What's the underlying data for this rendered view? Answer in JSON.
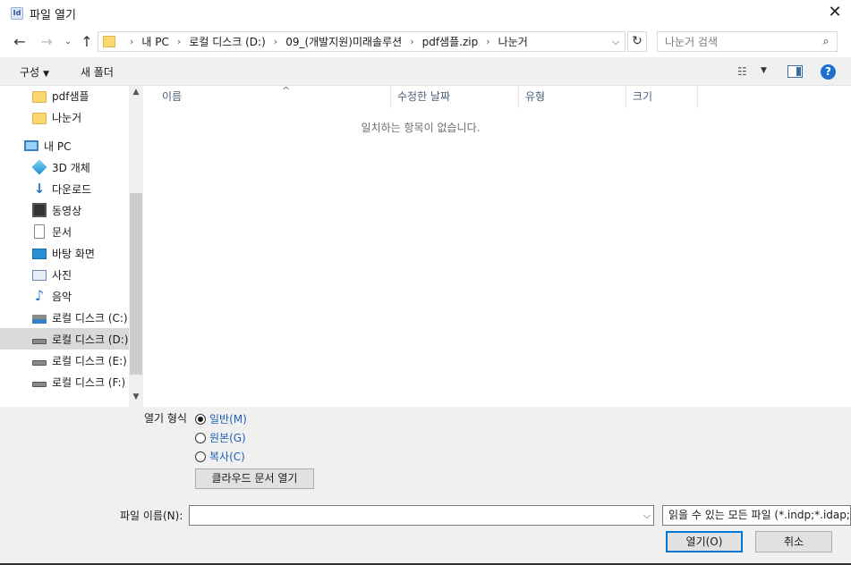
{
  "window": {
    "title": "파일 열기",
    "app_icon_text": "Id"
  },
  "address": {
    "crumbs": [
      "내 PC",
      "로컬 디스크 (D:)",
      "09_(개발지원)미래솔루션",
      "pdf샘플.zip",
      "나눈거"
    ]
  },
  "search": {
    "placeholder": "나눈거 검색"
  },
  "toolbar": {
    "organize_label": "구성",
    "new_folder_label": "새 폴더"
  },
  "nav_pane": {
    "items": [
      {
        "label": "pdf샘플",
        "icon": "folder-icon"
      },
      {
        "label": "나눈거",
        "icon": "folder-icon"
      },
      {
        "label": "내 PC",
        "icon": "computer-icon"
      },
      {
        "label": "3D 개체",
        "icon": "3d-objects-icon"
      },
      {
        "label": "다운로드",
        "icon": "download-icon"
      },
      {
        "label": "동영상",
        "icon": "video-icon"
      },
      {
        "label": "문서",
        "icon": "document-icon"
      },
      {
        "label": "바탕 화면",
        "icon": "desktop-icon"
      },
      {
        "label": "사진",
        "icon": "picture-icon"
      },
      {
        "label": "음악",
        "icon": "music-icon"
      },
      {
        "label": "로컬 디스크 (C:)",
        "icon": "drive-icon"
      },
      {
        "label": "로컬 디스크 (D:)",
        "icon": "drive-icon",
        "selected": true
      },
      {
        "label": "로컬 디스크 (E:)",
        "icon": "drive-icon"
      },
      {
        "label": "로컬 디스크 (F:)",
        "icon": "drive-icon"
      }
    ]
  },
  "file_list": {
    "columns": [
      "이름",
      "수정한 날짜",
      "유형",
      "크기"
    ],
    "empty_message": "일치하는 항목이 없습니다."
  },
  "open_as": {
    "label": "열기 형식",
    "options": [
      {
        "label": "일반(M)",
        "checked": true
      },
      {
        "label": "원본(G)",
        "checked": false
      },
      {
        "label": "복사(C)",
        "checked": false
      }
    ]
  },
  "cloud_button_label": "클라우드 문서 열기",
  "file_name": {
    "label": "파일 이름(N):",
    "value": ""
  },
  "file_type": {
    "selected": "읽을 수 있는 모든 파일 (*.indp;*.idap;*"
  },
  "buttons": {
    "open_label": "열기(O)",
    "cancel_label": "취소"
  },
  "colors": {
    "accent": "#0078d7",
    "link_blue": "#1e5fb4",
    "selected_row": "#d9d9d9"
  }
}
